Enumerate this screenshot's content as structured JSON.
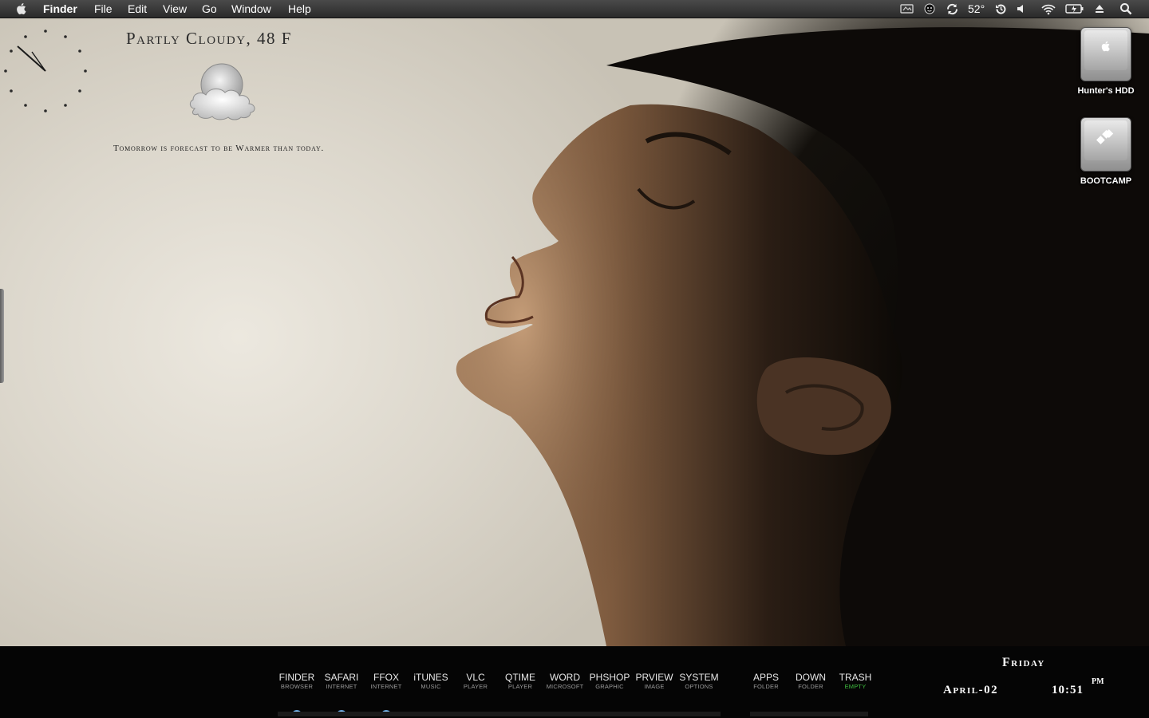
{
  "menubar": {
    "app_name": "Finder",
    "items": [
      "File",
      "Edit",
      "View",
      "Go",
      "Window",
      "Help"
    ],
    "temperature": "52°",
    "status_icons": [
      "menu-extra-icon",
      "face-icon",
      "sync-icon",
      "time-machine-icon",
      "volume-icon",
      "wifi-icon",
      "battery-icon",
      "eject-icon",
      "spotlight-icon"
    ]
  },
  "weather": {
    "title": "Partly Cloudy, 48 F",
    "forecast": "Tomorrow is forecast to be Warmer than today.",
    "icon": "partly-cloudy-icon"
  },
  "drives": [
    {
      "label": "Hunter's HDD",
      "icon": "apple-drive-icon"
    },
    {
      "label": "BOOTCAMP",
      "icon": "windows-drive-icon"
    }
  ],
  "dock": {
    "items": [
      {
        "name": "FINDER",
        "sub": "BROWSER"
      },
      {
        "name": "SAFARI",
        "sub": "INTERNET"
      },
      {
        "name": "FFOX",
        "sub": "INTERNET"
      },
      {
        "name": "iTUNES",
        "sub": "MUSIC"
      },
      {
        "name": "VLC",
        "sub": "PLAYER"
      },
      {
        "name": "QTIME",
        "sub": "PLAYER"
      },
      {
        "name": "WORD",
        "sub": "MICROSOFT"
      },
      {
        "name": "PHSHOP",
        "sub": "GRAPHIC"
      },
      {
        "name": "PRVIEW",
        "sub": "IMAGE"
      },
      {
        "name": "SYSTEM",
        "sub": "OPTIONS"
      },
      {
        "name": "APPS",
        "sub": "FOLDER"
      },
      {
        "name": "DOWN",
        "sub": "FOLDER"
      },
      {
        "name": "TRASH",
        "sub": "EMPTY"
      }
    ],
    "accent_green": "#3fbf3f"
  },
  "datetime": {
    "day": "Friday",
    "date": "April-02",
    "time": "10:51",
    "ampm": "PM"
  }
}
